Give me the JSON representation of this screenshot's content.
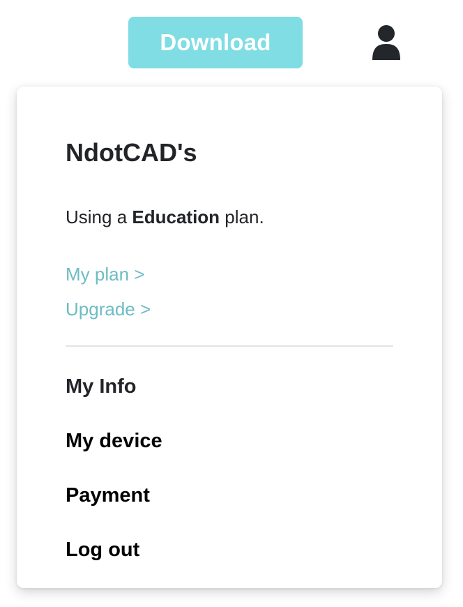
{
  "header": {
    "download_label": "Download",
    "profile_icon": "user-icon"
  },
  "account_menu": {
    "account_name": "NdotCAD's",
    "plan_prefix": "Using a ",
    "plan_name": "Education",
    "plan_suffix": " plan.",
    "links": [
      {
        "label": "My plan >"
      },
      {
        "label": "Upgrade >"
      }
    ],
    "items": [
      {
        "label": "My Info"
      },
      {
        "label": "My device"
      },
      {
        "label": "Payment"
      },
      {
        "label": "Log out"
      }
    ]
  },
  "colors": {
    "accent": "#7FDDE3",
    "link": "#6DBCC3",
    "text": "#222428",
    "text_strong": "#000000",
    "icon": "#23272B"
  }
}
